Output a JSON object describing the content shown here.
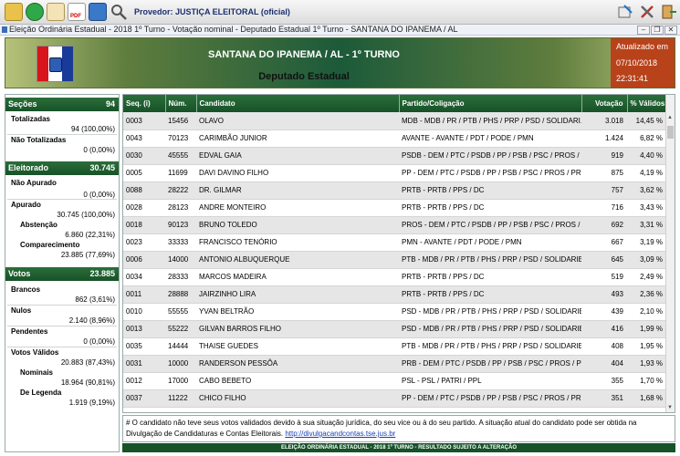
{
  "toolbar": {
    "provedor_text": "Provedor: JUSTIÇA ELEITORAL (oficial)",
    "pdf_label": "PDF",
    "icons": [
      "folder-icon",
      "refresh-icon",
      "edit-icon",
      "pdf-icon",
      "monitor-icon",
      "search-icon",
      "minimize-icon",
      "tools-icon",
      "exit-icon"
    ]
  },
  "window": {
    "title": "Eleição Ordinária Estadual - 2018 1º Turno - Votação nominal - Deputado Estadual 1º Turno - SANTANA DO IPANEMA / AL",
    "minimize_glyph": "–",
    "restore_glyph": "❐",
    "close_glyph": "✕"
  },
  "header": {
    "title": "SANTANA DO IPANEMA / AL - 1º TURNO",
    "subtitle": "Deputado Estadual",
    "updated_label": "Atualizado em",
    "updated_date": "07/10/2018",
    "updated_time": "22:31:41"
  },
  "summary": {
    "secoes": {
      "label": "Seções",
      "value": "94"
    },
    "totalizadas": {
      "label": "Totalizadas",
      "value": "94 (100,00%)"
    },
    "nao_totalizadas": {
      "label": "Não Totalizadas",
      "value": "0 (0,00%)"
    },
    "eleitorado": {
      "label": "Eleitorado",
      "value": "30.745"
    },
    "nao_apurado": {
      "label": "Não Apurado",
      "value": "0 (0,00%)"
    },
    "apurado": {
      "label": "Apurado",
      "value": "30.745 (100,00%)"
    },
    "abstencao": {
      "label": "Abstenção",
      "value": "6.860 (22,31%)"
    },
    "comparecimento": {
      "label": "Comparecimento",
      "value": "23.885 (77,69%)"
    },
    "votos": {
      "label": "Votos",
      "value": "23.885"
    },
    "brancos": {
      "label": "Brancos",
      "value": "862 (3,61%)"
    },
    "nulos": {
      "label": "Nulos",
      "value": "2.140 (8,96%)"
    },
    "pendentes": {
      "label": "Pendentes",
      "value": "0 (0,00%)"
    },
    "votos_validos": {
      "label": "Votos Válidos",
      "value": "20.883 (87,43%)"
    },
    "nominais": {
      "label": "Nominais",
      "value": "18.964 (90,81%)"
    },
    "de_legenda": {
      "label": "De Legenda",
      "value": "1.919 (9,19%)"
    }
  },
  "table": {
    "headers": [
      "Seq.  (i)",
      "Núm.",
      "Candidato",
      "Partido/Coligação",
      "Votação",
      "% Válidos"
    ],
    "rows": [
      [
        "0003",
        "15456",
        "OLAVO",
        "MDB - MDB / PR / PTB / PHS / PRP / PSD / SOLIDARI...",
        "3.018",
        "14,45 %"
      ],
      [
        "0043",
        "70123",
        "CARIMBÃO JUNIOR",
        "AVANTE - AVANTE / PDT / PODE / PMN",
        "1.424",
        "6,82 %"
      ],
      [
        "0030",
        "45555",
        "EDVAL GAIA",
        "PSDB - DEM / PTC / PSDB / PP / PSB / PSC / PROS / ...",
        "919",
        "4,40 %"
      ],
      [
        "0005",
        "11699",
        "DAVI DAVINO FILHO",
        "PP - DEM / PTC / PSDB / PP / PSB / PSC / PROS / PRB",
        "875",
        "4,19 %"
      ],
      [
        "0088",
        "28222",
        "DR. GILMAR",
        "PRTB - PRTB / PPS / DC",
        "757",
        "3,62 %"
      ],
      [
        "0028",
        "28123",
        "ANDRE MONTEIRO",
        "PRTB - PRTB / PPS / DC",
        "716",
        "3,43 %"
      ],
      [
        "0018",
        "90123",
        "BRUNO TOLEDO",
        "PROS - DEM / PTC / PSDB / PP / PSB / PSC / PROS / ...",
        "692",
        "3,31 %"
      ],
      [
        "0023",
        "33333",
        "FRANCISCO TENÓRIO",
        "PMN - AVANTE / PDT / PODE / PMN",
        "667",
        "3,19 %"
      ],
      [
        "0006",
        "14000",
        "ANTONIO ALBUQUERQUE",
        "PTB - MDB / PR / PTB / PHS / PRP / PSD / SOLIDARIE...",
        "645",
        "3,09 %"
      ],
      [
        "0034",
        "28333",
        "MARCOS MADEIRA",
        "PRTB - PRTB / PPS / DC",
        "519",
        "2,49 %"
      ],
      [
        "0011",
        "28888",
        "JAIRZINHO LIRA",
        "PRTB - PRTB / PPS / DC",
        "493",
        "2,36 %"
      ],
      [
        "0010",
        "55555",
        "YVAN BELTRÃO",
        "PSD - MDB / PR / PTB / PHS / PRP / PSD / SOLIDARIE...",
        "439",
        "2,10 %"
      ],
      [
        "0013",
        "55222",
        "GILVAN BARROS FILHO",
        "PSD - MDB / PR / PTB / PHS / PRP / PSD / SOLIDARIE...",
        "416",
        "1,99 %"
      ],
      [
        "0035",
        "14444",
        "THAISE GUEDES",
        "PTB - MDB / PR / PTB / PHS / PRP / PSD / SOLIDARIE...",
        "408",
        "1,95 %"
      ],
      [
        "0031",
        "10000",
        "RANDERSON PESSÔA",
        "PRB - DEM / PTC / PSDB / PP / PSB / PSC / PROS / PRB",
        "404",
        "1,93 %"
      ],
      [
        "0012",
        "17000",
        "CABO BEBETO",
        "PSL - PSL / PATRI / PPL",
        "355",
        "1,70 %"
      ],
      [
        "0037",
        "11222",
        "CHICO FILHO",
        "PP - DEM / PTC / PSDB / PP / PSB / PSC / PROS / PRB",
        "351",
        "1,68 %"
      ]
    ]
  },
  "note": {
    "text": "# O candidato não teve seus votos validados devido à sua situação jurídica, do seu vice ou à do seu partido. A situação atual do candidato pode ser obtida na Divulgação de Candidaturas e Contas Eleitorais.",
    "link": "http://divulgacandcontas.tse.jus.br"
  },
  "footer": {
    "text": "ELEIÇÃO ORDINÁRIA ESTADUAL - 2018 1º TURNO - RESULTADO SUJEITO A ALTERAÇÃO"
  },
  "colors": {
    "section_green": "#175228",
    "header_gradient_mid": "#1c5a3a",
    "updated_box": "#b8421a",
    "provedor_text": "#1b2f6e",
    "link": "#1a3fb0",
    "flag_red": "#d8141c",
    "flag_blue": "#1a3a9a"
  }
}
